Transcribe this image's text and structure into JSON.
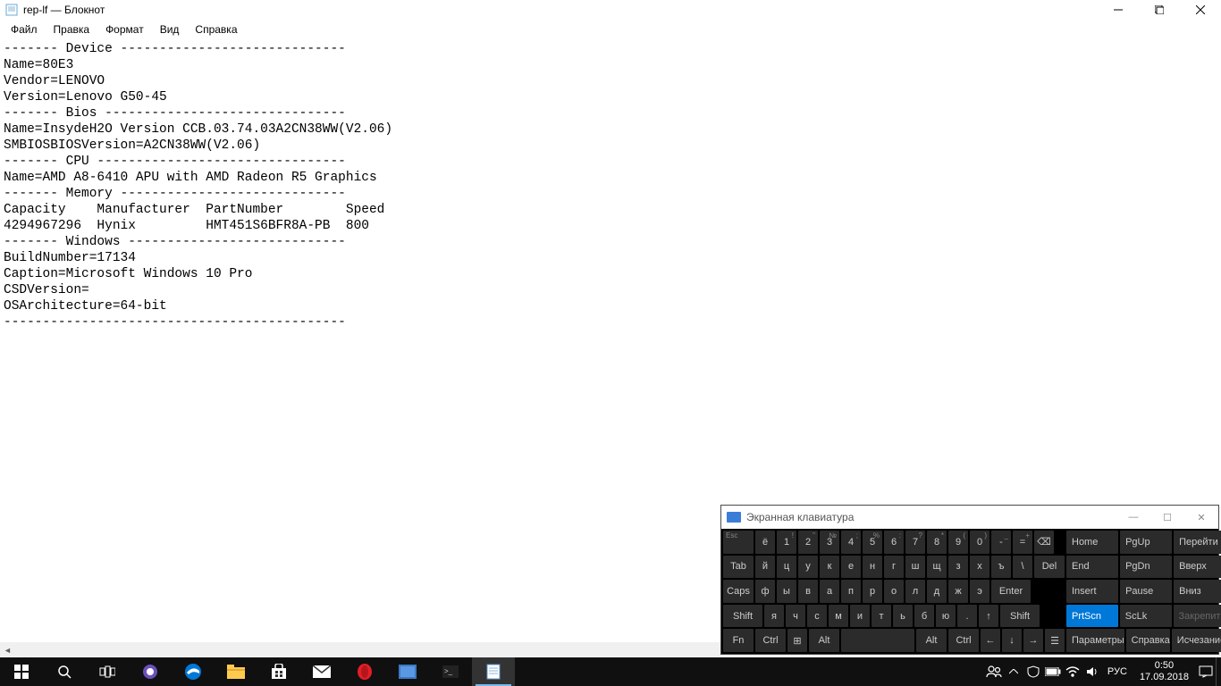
{
  "notepad": {
    "title": "rep-lf — Блокнот",
    "menu": [
      "Файл",
      "Правка",
      "Формат",
      "Вид",
      "Справка"
    ],
    "content": "------- Device -----------------------------\nName=80E3\nVendor=LENOVO\nVersion=Lenovo G50-45\n------- Bios -------------------------------\nName=InsydeH2O Version CCB.03.74.03A2CN38WW(V2.06)\nSMBIOSBIOSVersion=A2CN38WW(V2.06)\n------- CPU --------------------------------\nName=AMD A8-6410 APU with AMD Radeon R5 Graphics   \n------- Memory -----------------------------\nCapacity    Manufacturer  PartNumber        Speed\n4294967296  Hynix         HMT451S6BFR8A-PB  800  \n------- Windows ----------------------------\nBuildNumber=17134\nCaption=Microsoft Windows 10 Pro\nCSDVersion=\nOSArchitecture=64-bit\n--------------------------------------------"
  },
  "osk": {
    "title": "Экранная клавиатура",
    "rows": {
      "r1": [
        {
          "t": "Esc",
          "top": "Esc"
        },
        {
          "t": "ё"
        },
        {
          "t": "1",
          "s": "!"
        },
        {
          "t": "2",
          "s": "\""
        },
        {
          "t": "3",
          "s": "№"
        },
        {
          "t": "4",
          "s": ";"
        },
        {
          "t": "5",
          "s": "%"
        },
        {
          "t": "6",
          "s": ":"
        },
        {
          "t": "7",
          "s": "?"
        },
        {
          "t": "8",
          "s": "*"
        },
        {
          "t": "9",
          "s": "("
        },
        {
          "t": "0",
          "s": ")"
        },
        {
          "t": "-",
          "s": "_"
        },
        {
          "t": "=",
          "s": "+"
        },
        {
          "t": "⌫"
        }
      ],
      "r2": [
        {
          "t": "Tab"
        },
        {
          "t": "й"
        },
        {
          "t": "ц"
        },
        {
          "t": "у"
        },
        {
          "t": "к"
        },
        {
          "t": "е"
        },
        {
          "t": "н"
        },
        {
          "t": "г"
        },
        {
          "t": "ш"
        },
        {
          "t": "щ"
        },
        {
          "t": "з"
        },
        {
          "t": "х"
        },
        {
          "t": "ъ"
        },
        {
          "t": "\\"
        },
        {
          "t": "Del"
        }
      ],
      "r3": [
        {
          "t": "Caps"
        },
        {
          "t": "ф"
        },
        {
          "t": "ы"
        },
        {
          "t": "в"
        },
        {
          "t": "а"
        },
        {
          "t": "п"
        },
        {
          "t": "р"
        },
        {
          "t": "о"
        },
        {
          "t": "л"
        },
        {
          "t": "д"
        },
        {
          "t": "ж"
        },
        {
          "t": "э"
        },
        {
          "t": "Enter"
        }
      ],
      "r4": [
        {
          "t": "Shift"
        },
        {
          "t": "я"
        },
        {
          "t": "ч"
        },
        {
          "t": "с"
        },
        {
          "t": "м"
        },
        {
          "t": "и"
        },
        {
          "t": "т"
        },
        {
          "t": "ь"
        },
        {
          "t": "б"
        },
        {
          "t": "ю"
        },
        {
          "t": "."
        },
        {
          "t": "↑"
        },
        {
          "t": "Shift"
        }
      ],
      "r5": [
        {
          "t": "Fn"
        },
        {
          "t": "Ctrl"
        },
        {
          "t": "⊞"
        },
        {
          "t": "Alt"
        },
        {
          "t": ""
        },
        {
          "t": "Alt"
        },
        {
          "t": "Ctrl"
        },
        {
          "t": "←"
        },
        {
          "t": "↓"
        },
        {
          "t": "→"
        },
        {
          "t": "☰"
        }
      ]
    },
    "side": [
      [
        {
          "t": "Home"
        },
        {
          "t": "PgUp"
        },
        {
          "t": "Перейти"
        }
      ],
      [
        {
          "t": "End"
        },
        {
          "t": "PgDn"
        },
        {
          "t": "Вверх"
        }
      ],
      [
        {
          "t": "Insert"
        },
        {
          "t": "Pause"
        },
        {
          "t": "Вниз"
        }
      ],
      [
        {
          "t": "PrtScn",
          "active": true
        },
        {
          "t": "ScLk"
        },
        {
          "t": "Закрепить",
          "dim": true
        }
      ],
      [
        {
          "t": "Параметры"
        },
        {
          "t": "Справка"
        },
        {
          "t": "Исчезание"
        }
      ]
    ]
  },
  "taskbar": {
    "lang": "РУС",
    "time": "0:50",
    "date": "17.09.2018"
  }
}
